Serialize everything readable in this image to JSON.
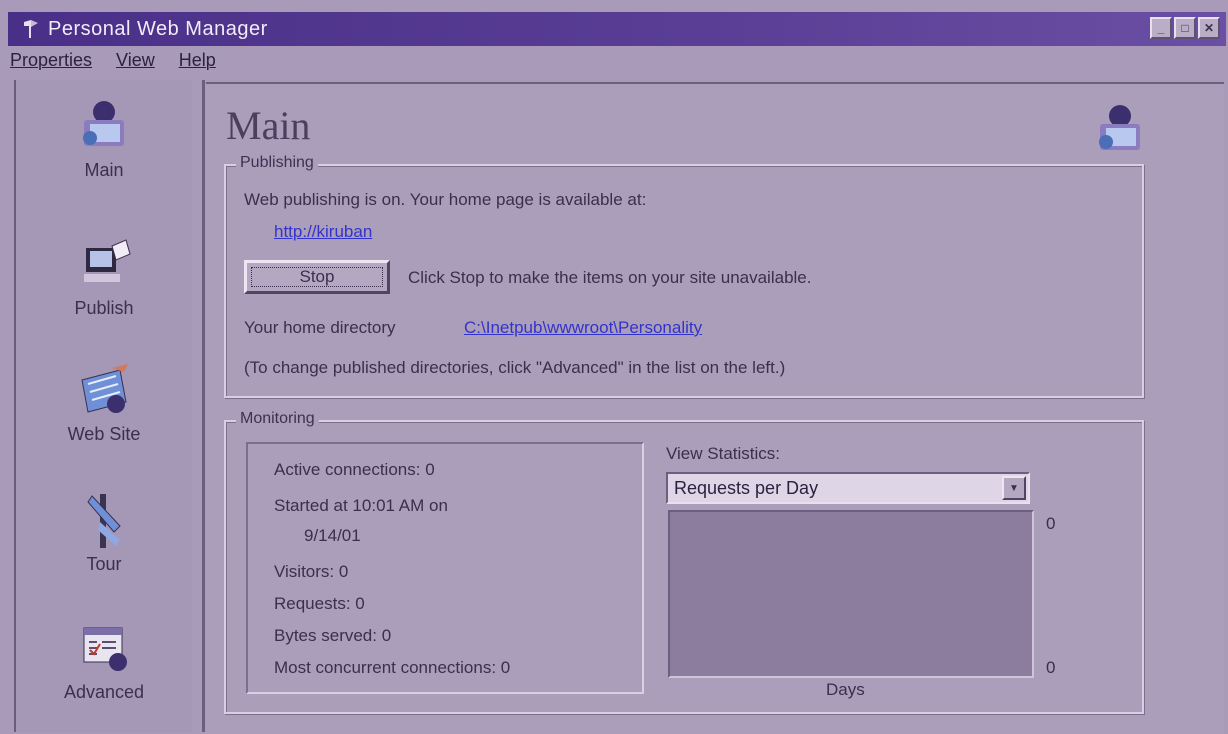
{
  "window": {
    "title": "Personal Web Manager",
    "buttons": [
      "minimize-icon",
      "maximize-icon",
      "close-icon"
    ]
  },
  "menu": {
    "items": [
      "Properties",
      "View",
      "Help"
    ]
  },
  "sidebar": {
    "items": [
      {
        "label": "Main",
        "icon": "main-icon"
      },
      {
        "label": "Publish",
        "icon": "publish-icon"
      },
      {
        "label": "Web Site",
        "icon": "web-site-icon"
      },
      {
        "label": "Tour",
        "icon": "tour-icon"
      },
      {
        "label": "Advanced",
        "icon": "advanced-icon"
      }
    ]
  },
  "main": {
    "title": "Main",
    "publishing": {
      "label": "Publishing",
      "status_text": "Web publishing is on. Your home page is available at:",
      "home_url": "http://kiruban",
      "stop_button": "Stop",
      "stop_hint": "Click Stop to make the items on your site unavailable.",
      "home_dir_label": "Your home directory",
      "home_dir_value": "C:\\Inetpub\\wwwroot\\Personality",
      "advanced_hint": "(To change published directories, click \"Advanced\" in the list on the left.)"
    },
    "monitoring": {
      "label": "Monitoring",
      "active_connections": "Active connections: 0",
      "started_line1": "Started at 10:01 AM on",
      "started_line2": "9/14/01",
      "visitors": "Visitors: 0",
      "requests": "Requests: 0",
      "bytes_served": "Bytes served: 0",
      "most_concurrent": "Most concurrent connections: 0",
      "view_stats_label": "View Statistics:",
      "view_stats_selected": "Requests per Day",
      "graph_max": "0",
      "graph_min": "0",
      "graph_xlabel": "Days"
    }
  },
  "colors": {
    "titlebar": "#4a2f88",
    "background": "#a89ab8",
    "link": "#3333cc"
  }
}
